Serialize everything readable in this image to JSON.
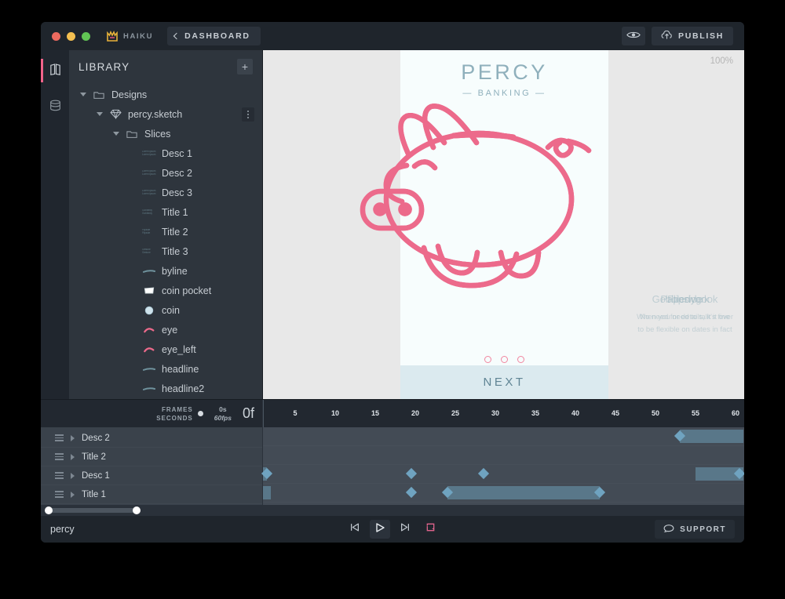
{
  "window": {
    "brand_name": "HAIKU",
    "dashboard_label": "DASHBOARD",
    "publish_label": "PUBLISH",
    "preview_icon": "eye-icon",
    "publish_icon": "upload-cloud-icon",
    "brand_icon": "haiku-logo-icon"
  },
  "rail": {
    "items": [
      {
        "name": "library",
        "icon": "library-book-icon",
        "active": true
      },
      {
        "name": "state-inspector",
        "icon": "database-icon",
        "active": false
      }
    ],
    "accent": "#f2638b"
  },
  "library": {
    "title": "LIBRARY",
    "add_label": "+",
    "tree": [
      {
        "label": "Designs",
        "depth": 0,
        "icon": "folder-icon",
        "caret": true,
        "kebab": false
      },
      {
        "label": "percy.sketch",
        "depth": 1,
        "icon": "sketch-diamond-icon",
        "caret": true,
        "kebab": true
      },
      {
        "label": "Slices",
        "depth": 2,
        "icon": "folder-icon",
        "caret": true,
        "kebab": false
      },
      {
        "label": "Desc 1",
        "depth": 3,
        "icon": "text-thumb-icon",
        "caret": false,
        "kebab": false,
        "thumb": "Lorem ipsum"
      },
      {
        "label": "Desc 2",
        "depth": 3,
        "icon": "text-thumb-icon",
        "caret": false,
        "kebab": false,
        "thumb": "Lorem ipsum"
      },
      {
        "label": "Desc 3",
        "depth": 3,
        "icon": "text-thumb-icon",
        "caret": false,
        "kebab": false,
        "thumb": "Lorem ipsum"
      },
      {
        "label": "Title 1",
        "depth": 3,
        "icon": "text-thumb-icon",
        "caret": false,
        "kebab": false,
        "thumb": "Gobbledy"
      },
      {
        "label": "Title 2",
        "depth": 3,
        "icon": "text-thumb-icon",
        "caret": false,
        "kebab": false,
        "thumb": "Flipside"
      },
      {
        "label": "Title 3",
        "depth": 3,
        "icon": "text-thumb-icon",
        "caret": false,
        "kebab": false,
        "thumb": "Gesture"
      },
      {
        "label": "byline",
        "depth": 3,
        "icon": "line-shape-icon",
        "caret": false,
        "kebab": false
      },
      {
        "label": "coin pocket",
        "depth": 3,
        "icon": "pocket-shape-icon",
        "caret": false,
        "kebab": false
      },
      {
        "label": "coin",
        "depth": 3,
        "icon": "circle-shape-icon",
        "caret": false,
        "kebab": false
      },
      {
        "label": "eye",
        "depth": 3,
        "icon": "eye-arc-shape-icon",
        "caret": false,
        "kebab": false
      },
      {
        "label": "eye_left",
        "depth": 3,
        "icon": "eye-arc-shape-icon",
        "caret": false,
        "kebab": false
      },
      {
        "label": "headline",
        "depth": 3,
        "icon": "line-shape-icon",
        "caret": false,
        "kebab": false
      },
      {
        "label": "headline2",
        "depth": 3,
        "icon": "line-shape-icon",
        "caret": false,
        "kebab": false
      }
    ]
  },
  "stage": {
    "zoom_label": "100%",
    "background": "#e8e8e8",
    "artboard": {
      "background": "#f7fdfd",
      "title": "PERCY",
      "subtitle": "— BANKING —",
      "pager_dots": 3,
      "pager_color": "#f1859f",
      "next_label": "NEXT",
      "next_bar_color": "#dbeaef",
      "illustration": "piggy-bank-illustration",
      "illustration_color": "#ec6a8b"
    },
    "ghost_text": {
      "titles": [
        "Gobbledygook",
        "Flipside",
        "Paperwork"
      ],
      "bodies": [
        "When you need to talk it over",
        "No need for details, it's fine",
        "to be flexible on dates in fact"
      ]
    }
  },
  "timeline": {
    "units_primary": "FRAMES",
    "units_secondary": "SECONDS",
    "time_value": "0s",
    "fps": "60fps",
    "frame_counter": "0f",
    "ruler_ticks": [
      "5",
      "10",
      "15",
      "20",
      "25",
      "30",
      "35",
      "40",
      "45",
      "50",
      "55",
      "60"
    ],
    "rows": [
      {
        "label": "Desc 2",
        "keyframes": [
          53
        ],
        "segments": [
          [
            53,
            61
          ]
        ]
      },
      {
        "label": "Title 2",
        "keyframes": [],
        "segments": []
      },
      {
        "label": "Desc 1",
        "keyframes": [
          1.5,
          19.5,
          28.5,
          60.5
        ],
        "segments": [
          [
            0,
            1.5
          ],
          [
            55,
            61
          ]
        ]
      },
      {
        "label": "Title 1",
        "keyframes": [
          19.5,
          24,
          43
        ],
        "segments": [
          [
            0,
            2
          ],
          [
            24,
            43
          ]
        ]
      }
    ],
    "scroll_position": 0
  },
  "footer": {
    "project_name": "percy",
    "transport": [
      {
        "name": "skip-to-start",
        "icon": "skip-back-icon",
        "active": false
      },
      {
        "name": "play",
        "icon": "play-icon",
        "active": true
      },
      {
        "name": "skip-to-end",
        "icon": "skip-forward-icon",
        "active": false
      },
      {
        "name": "loop",
        "icon": "loop-icon",
        "active": false
      }
    ],
    "support_label": "SUPPORT",
    "support_icon": "chat-bubble-icon",
    "loop_color": "#e0648c"
  }
}
